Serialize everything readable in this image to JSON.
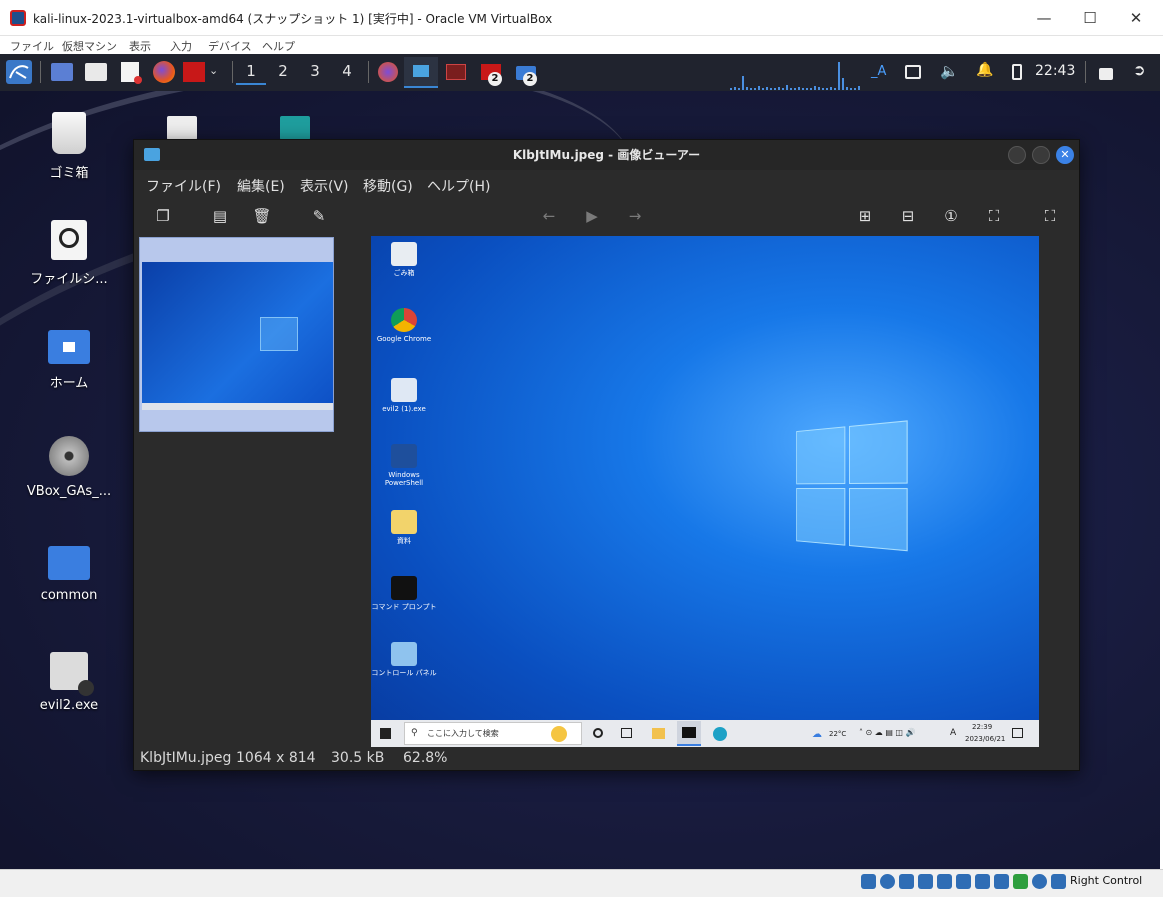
{
  "vbox": {
    "title": "kali-linux-2023.1-virtualbox-amd64 (スナップショット 1) [実行中] - Oracle VM VirtualBox",
    "menu": [
      "ファイル",
      "仮想マシン",
      "表示",
      "入力",
      "デバイス",
      "ヘルプ"
    ],
    "status_right": "Right Control"
  },
  "panel": {
    "workspaces": [
      "1",
      "2",
      "3",
      "4"
    ],
    "active_workspace": "1",
    "badge_a": "2",
    "badge_b": "2",
    "tray_text": "_A",
    "clock": "22:43"
  },
  "desktop": {
    "icons": [
      {
        "label": "ゴミ箱",
        "icon": "trash-icon"
      },
      {
        "label": "ファイルシ...",
        "icon": "drive-icon"
      },
      {
        "label": "ホーム",
        "icon": "home-folder-icon"
      },
      {
        "label": "VBox_GAs_...",
        "icon": "disc-icon"
      },
      {
        "label": "common",
        "icon": "folder-icon"
      },
      {
        "label": "evil2.exe",
        "icon": "exe-locked-icon"
      }
    ]
  },
  "viewer": {
    "title": "KlbJtIMu.jpeg - 画像ビューアー",
    "menu": [
      "ファイル(F)",
      "編集(E)",
      "表示(V)",
      "移動(G)",
      "ヘルプ(H)"
    ],
    "status": {
      "filename": "KlbJtIMu.jpeg",
      "dimensions": "1064 x 814",
      "size": "30.5 kB",
      "zoom": "62.8%"
    }
  },
  "screenshot": {
    "icons": [
      "ごみ箱",
      "Google Chrome",
      "evil2 (1).exe",
      "Windows PowerShell",
      "資料",
      "コマンド プロンプト",
      "コントロール パネル"
    ],
    "search_placeholder": "ここに入力して検索",
    "weather": "22°C",
    "ime": "A",
    "time": "22:39",
    "date": "2023/06/21"
  }
}
